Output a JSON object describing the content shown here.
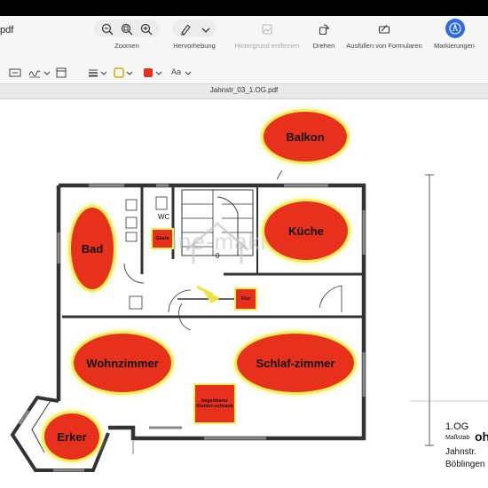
{
  "window": {
    "doc_title": "pdf"
  },
  "toolbar": {
    "zoom_label": "Zoomen",
    "highlight_label": "Hervorhebung",
    "bg_remove_label": "Hintergrund entfernen",
    "rotate_label": "Drehen",
    "form_label": "Ausfüllen von Formularen",
    "markup_label": "Markierungen"
  },
  "toolbar2": {
    "font_label": "Aa",
    "accent_color": "#e8311c",
    "border_color": "#d6c23a"
  },
  "tab": {
    "filename": "Jahnstr_03_1.OG.pdf"
  },
  "floorplan": {
    "rooms": {
      "balkon": "Balkon",
      "bad": "Bad",
      "kueche": "Küche",
      "wohnzimmer": "Wohnzimmer",
      "schlafzimmer": "Schlaf-zimmer",
      "erker": "Erker"
    },
    "small_labels": {
      "gaeste": "Gäste",
      "flur": "Flur",
      "schrank": "begehbarer Kleider-schrank"
    },
    "wc_label": "WC",
    "stair_number": "0",
    "watermark": "ohne-makler"
  },
  "titleblock": {
    "floor": "1.OG",
    "scale_label": "Maßstab",
    "scale_logo": "oh",
    "street": "Jahnstr.",
    "city": "Böblingen"
  },
  "colors": {
    "room_fill": "#e8311c",
    "room_glow": "#f2ee5a",
    "markup_blue": "#2f6be0"
  }
}
